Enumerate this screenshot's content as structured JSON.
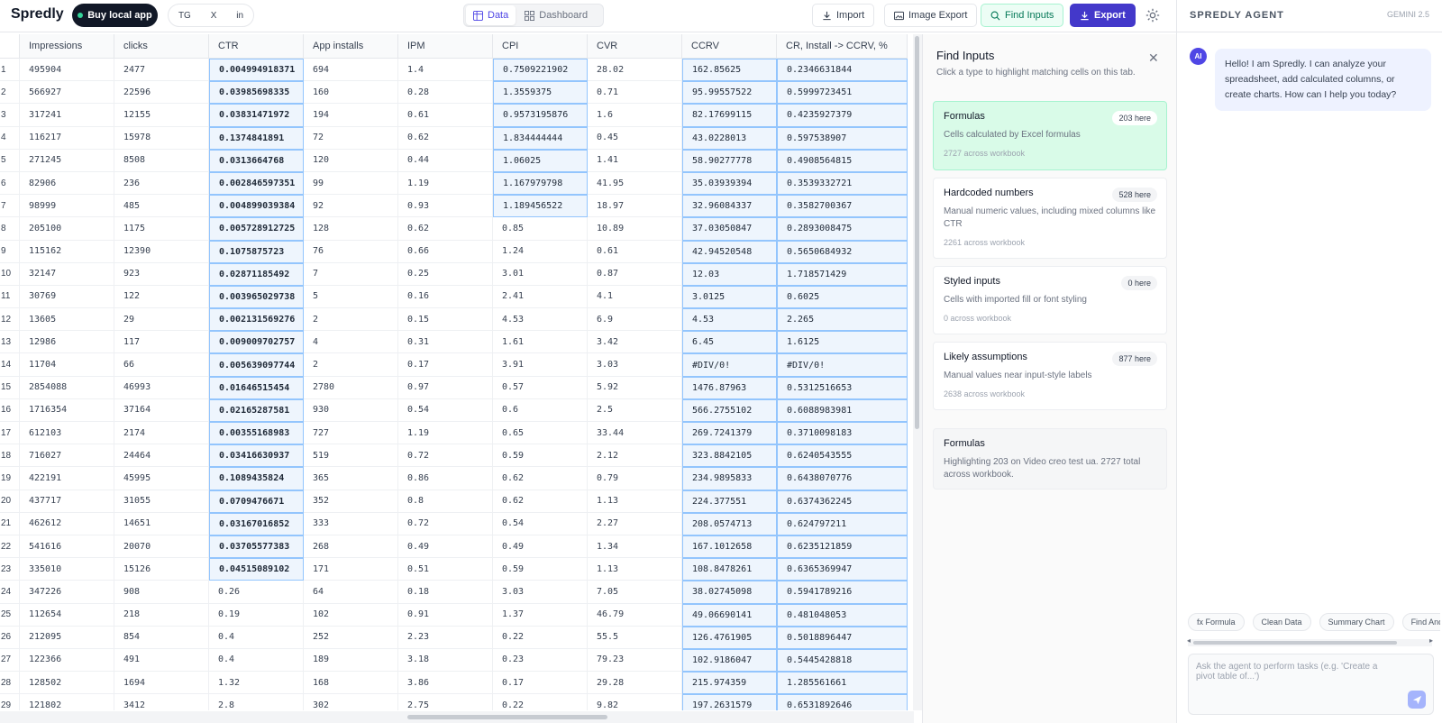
{
  "header": {
    "logo": "Spredly",
    "buy_label": "Buy local app",
    "social": [
      "TG",
      "X",
      "in"
    ],
    "tabs": [
      {
        "label": "Data"
      },
      {
        "label": "Dashboard"
      }
    ],
    "import_label": "Import",
    "image_export_label": "Image Export",
    "find_inputs_label": "Find Inputs",
    "export_label": "Export"
  },
  "grid": {
    "columns": [
      "Impressions",
      "clicks",
      "CTR",
      "App installs",
      "IPM",
      "CPI",
      "CVR",
      "CCRV",
      "CR, Install -> CCRV, %"
    ],
    "rows": [
      [
        "1",
        "495904",
        "2477",
        "0.004994918371",
        "694",
        "1.4",
        "0.7509221902",
        "28.02",
        "162.85625",
        "0.2346631844"
      ],
      [
        "2",
        "566927",
        "22596",
        "0.03985698335",
        "160",
        "0.28",
        "1.3559375",
        "0.71",
        "95.99557522",
        "0.5999723451"
      ],
      [
        "3",
        "317241",
        "12155",
        "0.03831471972",
        "194",
        "0.61",
        "0.9573195876",
        "1.6",
        "82.17699115",
        "0.4235927379"
      ],
      [
        "4",
        "116217",
        "15978",
        "0.1374841891",
        "72",
        "0.62",
        "1.834444444",
        "0.45",
        "43.0228013",
        "0.597538907"
      ],
      [
        "5",
        "271245",
        "8508",
        "0.0313664768",
        "120",
        "0.44",
        "1.06025",
        "1.41",
        "58.90277778",
        "0.4908564815"
      ],
      [
        "6",
        "82906",
        "236",
        "0.002846597351",
        "99",
        "1.19",
        "1.167979798",
        "41.95",
        "35.03939394",
        "0.3539332721"
      ],
      [
        "7",
        "98999",
        "485",
        "0.004899039384",
        "92",
        "0.93",
        "1.189456522",
        "18.97",
        "32.96084337",
        "0.3582700367"
      ],
      [
        "8",
        "205100",
        "1175",
        "0.005728912725",
        "128",
        "0.62",
        "0.85",
        "10.89",
        "37.03050847",
        "0.2893008475"
      ],
      [
        "9",
        "115162",
        "12390",
        "0.1075875723",
        "76",
        "0.66",
        "1.24",
        "0.61",
        "42.94520548",
        "0.5650684932"
      ],
      [
        "10",
        "32147",
        "923",
        "0.02871185492",
        "7",
        "0.25",
        "3.01",
        "0.87",
        "12.03",
        "1.718571429"
      ],
      [
        "11",
        "30769",
        "122",
        "0.003965029738",
        "5",
        "0.16",
        "2.41",
        "4.1",
        "3.0125",
        "0.6025"
      ],
      [
        "12",
        "13605",
        "29",
        "0.002131569276",
        "2",
        "0.15",
        "4.53",
        "6.9",
        "4.53",
        "2.265"
      ],
      [
        "13",
        "12986",
        "117",
        "0.009009702757",
        "4",
        "0.31",
        "1.61",
        "3.42",
        "6.45",
        "1.6125"
      ],
      [
        "14",
        "11704",
        "66",
        "0.005639097744",
        "2",
        "0.17",
        "3.91",
        "3.03",
        "#DIV/0!",
        "#DIV/0!"
      ],
      [
        "15",
        "2854088",
        "46993",
        "0.01646515454",
        "2780",
        "0.97",
        "0.57",
        "5.92",
        "1476.87963",
        "0.5312516653"
      ],
      [
        "16",
        "1716354",
        "37164",
        "0.02165287581",
        "930",
        "0.54",
        "0.6",
        "2.5",
        "566.2755102",
        "0.6088983981"
      ],
      [
        "17",
        "612103",
        "2174",
        "0.00355168983",
        "727",
        "1.19",
        "0.65",
        "33.44",
        "269.7241379",
        "0.3710098183"
      ],
      [
        "18",
        "716027",
        "24464",
        "0.03416630937",
        "519",
        "0.72",
        "0.59",
        "2.12",
        "323.8842105",
        "0.6240543555"
      ],
      [
        "19",
        "422191",
        "45995",
        "0.1089435824",
        "365",
        "0.86",
        "0.62",
        "0.79",
        "234.9895833",
        "0.6438070776"
      ],
      [
        "20",
        "437717",
        "31055",
        "0.0709476671",
        "352",
        "0.8",
        "0.62",
        "1.13",
        "224.377551",
        "0.6374362245"
      ],
      [
        "21",
        "462612",
        "14651",
        "0.03167016852",
        "333",
        "0.72",
        "0.54",
        "2.27",
        "208.0574713",
        "0.624797211"
      ],
      [
        "22",
        "541616",
        "20070",
        "0.03705577383",
        "268",
        "0.49",
        "0.49",
        "1.34",
        "167.1012658",
        "0.6235121859"
      ],
      [
        "23",
        "335010",
        "15126",
        "0.04515089102",
        "171",
        "0.51",
        "0.59",
        "1.13",
        "108.8478261",
        "0.6365369947"
      ],
      [
        "24",
        "347226",
        "908",
        "0.26",
        "64",
        "0.18",
        "3.03",
        "7.05",
        "38.02745098",
        "0.5941789216"
      ],
      [
        "25",
        "112654",
        "218",
        "0.19",
        "102",
        "0.91",
        "1.37",
        "46.79",
        "49.06690141",
        "0.481048053"
      ],
      [
        "26",
        "212095",
        "854",
        "0.4",
        "252",
        "2.23",
        "0.22",
        "55.5",
        "126.4761905",
        "0.5018896447"
      ],
      [
        "27",
        "122366",
        "491",
        "0.4",
        "189",
        "3.18",
        "0.23",
        "79.23",
        "102.9186047",
        "0.5445428818"
      ],
      [
        "28",
        "128502",
        "1694",
        "1.32",
        "168",
        "3.86",
        "0.17",
        "29.28",
        "215.974359",
        "1.285561661"
      ],
      [
        "29",
        "121802",
        "3412",
        "2.8",
        "302",
        "2.75",
        "0.22",
        "9.82",
        "197.2631579",
        "0.6531892646"
      ]
    ]
  },
  "find_inputs": {
    "title": "Find Inputs",
    "subtitle": "Click a type to highlight matching cells on this tab.",
    "cards": [
      {
        "title": "Formulas",
        "badge": "203 here",
        "desc": "Cells calculated by Excel formulas",
        "foot": "2727 across workbook"
      },
      {
        "title": "Hardcoded numbers",
        "badge": "528 here",
        "desc": "Manual numeric values, including mixed columns like CTR",
        "foot": "2261 across workbook"
      },
      {
        "title": "Styled inputs",
        "badge": "0 here",
        "desc": "Cells with imported fill or font styling",
        "foot": "0 across workbook"
      },
      {
        "title": "Likely assumptions",
        "badge": "877 here",
        "desc": "Manual values near input-style labels",
        "foot": "2638 across workbook"
      }
    ],
    "summary": {
      "title": "Formulas",
      "text": "Highlighting 203 on Video creo test ua. 2727 total across workbook."
    }
  },
  "agent": {
    "title": "SPREDLY AGENT",
    "model": "GEMINI 2.5",
    "avatar": "AI",
    "message": "Hello! I am Spredly. I can analyze your spreadsheet, add calculated columns, or create charts. How can I help you today?",
    "chips": [
      "fx Formula",
      "Clean Data",
      "Summary Chart",
      "Find Anomalies"
    ],
    "input_placeholder": "Ask the agent to perform tasks (e.g. 'Create a pivot table of...')"
  },
  "colors": {
    "accent": "#4338ca",
    "find_active": "#d9fbe8",
    "highlight_fill": "#eef5fd",
    "highlight_border": "#93c5fd"
  }
}
